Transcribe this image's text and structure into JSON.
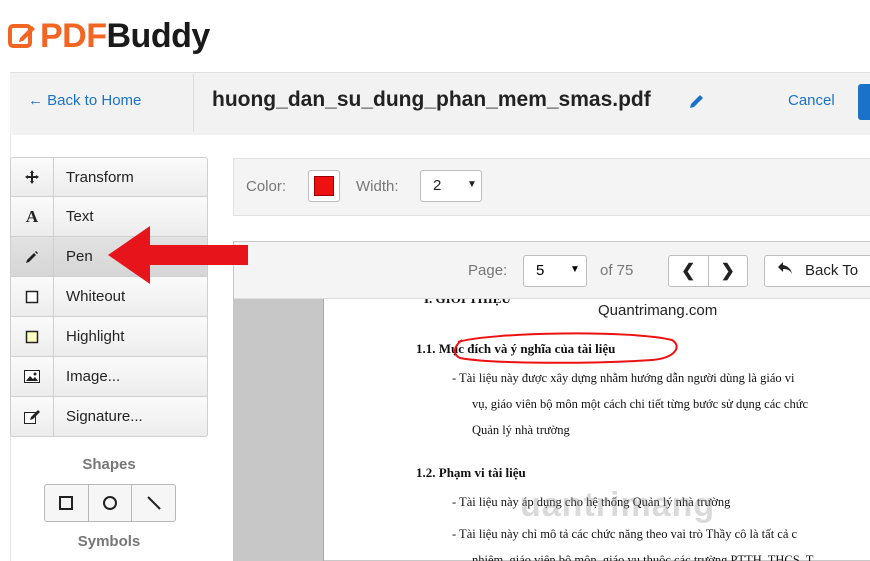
{
  "brand": {
    "logo_pdf": "PDF",
    "logo_buddy": "Buddy"
  },
  "header": {
    "back_label": "← Back to Home",
    "filename": "huong_dan_su_dung_phan_mem_smas.pdf",
    "cancel_label": "Cancel"
  },
  "tools": [
    {
      "label": "Transform",
      "icon": "move-icon"
    },
    {
      "label": "Text",
      "icon": "text-icon"
    },
    {
      "label": "Pen",
      "icon": "pen-icon"
    },
    {
      "label": "Whiteout",
      "icon": "whiteout-icon"
    },
    {
      "label": "Highlight",
      "icon": "highlight-icon"
    },
    {
      "label": "Image...",
      "icon": "image-icon"
    },
    {
      "label": "Signature...",
      "icon": "signature-icon"
    }
  ],
  "shapes_label": "Shapes",
  "symbols_label": "Symbols",
  "options": {
    "color_label": "Color:",
    "color_value": "#ee1111",
    "width_label": "Width:",
    "width_value": "2"
  },
  "nav": {
    "page_label": "Page:",
    "page_value": "5",
    "of_label": "of 75",
    "back_to_label": "Back To"
  },
  "document": {
    "site": "Quantrimang.com",
    "heading_cut": "I.  GIỚI THIỆU",
    "h1": "1.1.   Mục đích và ý nghĩa của tài liệu",
    "p1_l1": "-   Tài liệu này được xây dựng nhằm hướng dẫn người dùng là giáo vi",
    "p1_l2": "vụ, giáo viên bộ môn một cách chi tiết từng bước sử dụng các chức",
    "p1_l3": "Quản lý nhà trường",
    "h2": "1.2.   Phạm vi tài liệu",
    "p2_l1": "-   Tài liệu này áp dụng cho hệ thống Quản lý nhà trường",
    "p2_l2": "-   Tài liệu này chỉ mô tả các chức năng theo vai trò Thầy cô là tất cả c",
    "p2_l3": "nhiệm, giáo viên bộ môn, giáo vụ thuộc các trường PTTH, THCS, T",
    "watermark": "uantrimang"
  },
  "colors": {
    "accent": "#1a73c8",
    "brand_orange": "#f26522",
    "arrow": "#e8141c",
    "pen_color": "#ee1111"
  }
}
